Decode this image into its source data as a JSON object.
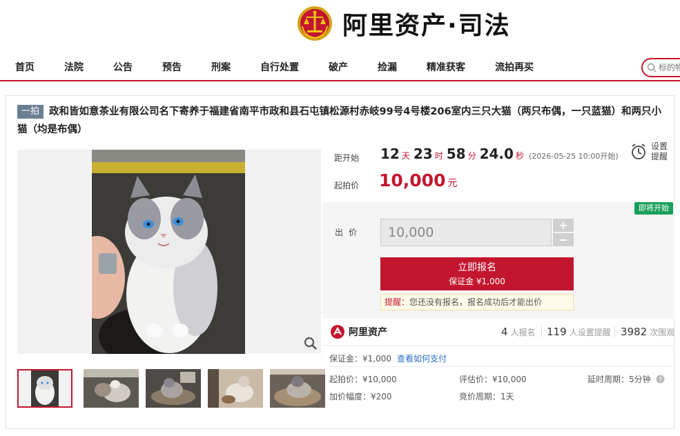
{
  "header": {
    "logo_text": "阿里资产·司法",
    "emblem_icon": "court-emblem-icon"
  },
  "nav": {
    "items": [
      "首页",
      "法院",
      "公告",
      "预告",
      "刑案",
      "自行处置",
      "破产",
      "捡漏",
      "精准获客",
      "流拍再买"
    ],
    "search_placeholder": "标的物"
  },
  "auction": {
    "badge": "一拍",
    "title": "政和皆如意茶业有限公司名下寄养于福建省南平市政和县石屯镇松源村赤岐99号4号楼206室内三只大猫（两只布偶，一只蓝猫）和两只小猫（均是布偶）",
    "countdown": {
      "label": "距开始",
      "days": "12",
      "days_unit": "天",
      "hours": "23",
      "hours_unit": "时",
      "minutes": "58",
      "minutes_unit": "分",
      "seconds": "24.0",
      "seconds_unit": "秒",
      "start_note": "(2026-05-25 10:00开始)"
    },
    "remind": {
      "line1": "设置",
      "line2": "提醒"
    },
    "start_price": {
      "label": "起拍价",
      "value": "10,000",
      "unit": "元"
    },
    "status_tag": "即将开始",
    "bid": {
      "label": "出价",
      "value": "10,000",
      "plus": "+",
      "minus": "−"
    },
    "register": {
      "label": "立即报名",
      "deposit": "保证金 ¥1,000"
    },
    "tip": {
      "prefix": "提醒：",
      "text": "您还没有报名，报名成功后才能出价"
    },
    "stats": {
      "brand": "阿里资产",
      "signups": "4",
      "signups_label": "人报名",
      "reminders": "119",
      "reminders_label": "人设置提醒",
      "views": "3982",
      "views_label": "次围观"
    },
    "details": {
      "deposit": "保证金：¥1,000",
      "how_to_pay": "查看如何支付",
      "start_price": "起拍价：¥10,000",
      "appraisal": "评估价：¥10,000",
      "delay": "延时周期：5分钟",
      "increment": "加价幅度：¥200",
      "period": "竞价周期：1天"
    }
  },
  "colors": {
    "brand_red": "#c3162e",
    "tag_green": "#19a05a",
    "badge_gray": "#6b7f93",
    "link_blue": "#2b72c8"
  }
}
